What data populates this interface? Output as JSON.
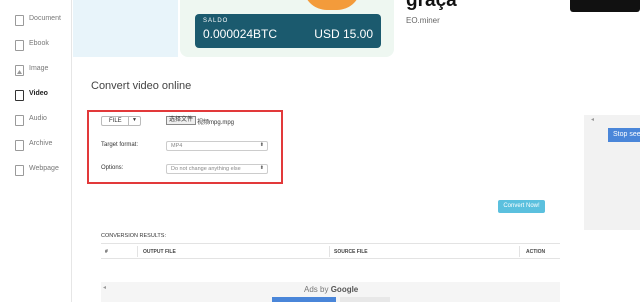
{
  "sidebar": {
    "items": [
      {
        "label": "Document",
        "icon": "document-icon",
        "active": false
      },
      {
        "label": "Ebook",
        "icon": "ebook-icon",
        "active": false
      },
      {
        "label": "Image",
        "icon": "image-icon",
        "active": false
      },
      {
        "label": "Video",
        "icon": "video-icon",
        "active": true
      },
      {
        "label": "Audio",
        "icon": "audio-icon",
        "active": false
      },
      {
        "label": "Archive",
        "icon": "archive-icon",
        "active": false
      },
      {
        "label": "Webpage",
        "icon": "webpage-icon",
        "active": false
      }
    ]
  },
  "top_ad": {
    "saldo_label": "SALDO",
    "btc_value": "0.000024BTC",
    "usd_value": "USD 15.00",
    "headline": "graça",
    "subtitle": "EO.miner"
  },
  "main": {
    "title": "Convert video online",
    "file_button": "FILE",
    "choose_file": "选择文件",
    "chosen_file_name": "视频mpg.mpg",
    "target_format_label": "Target format:",
    "target_format_value": "MP4",
    "options_label": "Options:",
    "options_value": "Do not change anything else",
    "convert_button": "Convert Now!",
    "results_label": "CONVERSION RESULTS:",
    "columns": [
      "#",
      "OUTPUT FILE",
      "SOURCE FILE",
      "ACTION"
    ]
  },
  "bottom_ad": {
    "ads_by": "Ads by",
    "google": "Google"
  },
  "right_ad": {
    "stop_button": "Stop seeing"
  },
  "colors": {
    "highlight_border": "#e2393a",
    "convert_button": "#5bc0de",
    "saldo_bg": "#1b5a6e",
    "ad_blue": "#4a86d9"
  }
}
